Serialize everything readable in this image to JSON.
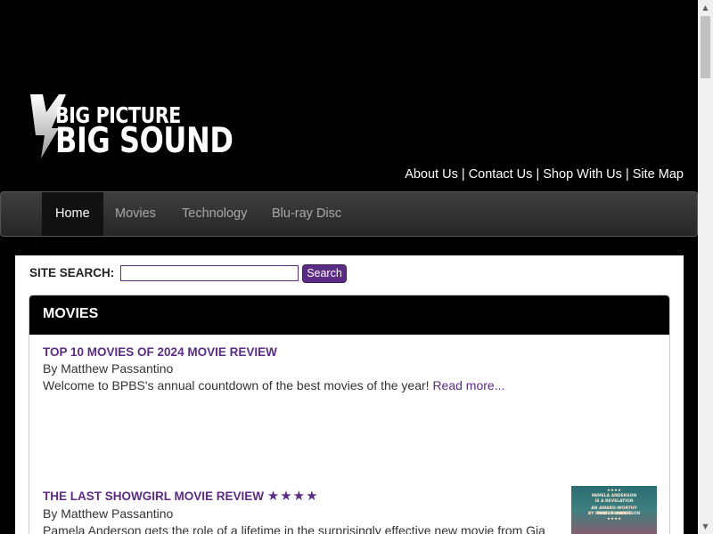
{
  "logo": {
    "line1": "BIG PICTURE",
    "line2": "BIG SOUND"
  },
  "toplinks": [
    "About Us",
    "Contact Us",
    "Shop With Us",
    "Site Map"
  ],
  "toplinks_separator": "|",
  "nav": [
    "Home",
    "Movies",
    "Technology",
    "Blu-ray Disc"
  ],
  "nav_active": "Home",
  "search": {
    "label": "SITE SEARCH:",
    "value": "",
    "button": "Search"
  },
  "panel": {
    "title": "MOVIES"
  },
  "articles": [
    {
      "title": "TOP 10 MOVIES OF 2024 MOVIE REVIEW",
      "byline": "By Matthew Passantino",
      "summary": "Welcome to BPBS's annual countdown of the best movies of the year!",
      "read_more": "Read more..."
    },
    {
      "title": "THE LAST SHOWGIRL MOVIE REVIEW",
      "stars": "★★★★",
      "byline": "By Matthew Passantino",
      "summary": "Pamela Anderson gets the role of a lifetime in the surprisingly effective new movie from Gia",
      "poster_text": [
        "★★★★",
        "PAMELA ANDERSON",
        "IS A REVELATION",
        "AN AWARD-WORTHY PERFORMANCE",
        "BY PAMELA ANDERSON",
        "★★★★"
      ]
    }
  ],
  "colors": {
    "accent": "#5b2c83",
    "header_bg": "#000000",
    "nav_bg": "#333333"
  },
  "scrollbar": {
    "up_icon": "▲",
    "down_icon": "▼"
  }
}
